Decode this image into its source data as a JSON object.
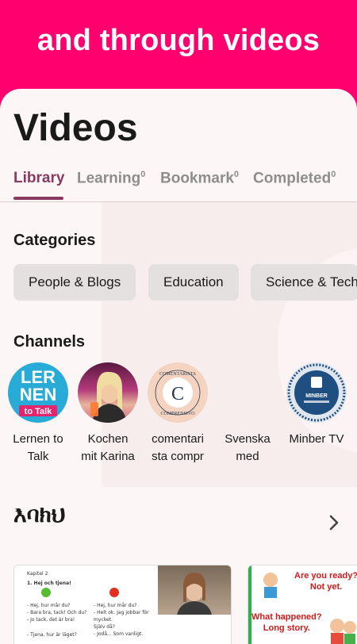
{
  "banner": {
    "title": "and through videos"
  },
  "page": {
    "title": "Videos"
  },
  "tabs": [
    {
      "label": "Library",
      "count": ""
    },
    {
      "label": "Learning",
      "count": "0"
    },
    {
      "label": "Bookmark",
      "count": "0"
    },
    {
      "label": "Completed",
      "count": "0"
    }
  ],
  "categories": {
    "title": "Categories",
    "items": [
      "People & Blogs",
      "Education",
      "Science & Tech"
    ]
  },
  "channels": {
    "title": "Channels",
    "items": [
      {
        "name": "Lernen to\nTalk",
        "logo_lines": [
          "LER",
          "NEN"
        ],
        "logo_sub": "to Talk",
        "color": "#29abd8"
      },
      {
        "name": "Kochen\nmit Karina",
        "color": "#c2307a"
      },
      {
        "name": "comentari\nsta compr",
        "logo_letter": "C",
        "logo_ring_top": "COMENTARISTA",
        "logo_ring_bottom": "COMPRENSIVO",
        "color": "#f4d4c0"
      },
      {
        "name": "Svenska\nmed",
        "color": "#fdf6f6"
      },
      {
        "name": "Minber TV",
        "logo_text": "MINBER",
        "color": "#1f4f80"
      }
    ]
  },
  "section": {
    "title": "እባክህ"
  },
  "thumbs": {
    "first": {
      "heading": "Kapitel 2",
      "sub": "1. Hej och tjena!",
      "lines_left": [
        "- Hej, hur mår du?",
        "- Bara bra, tack! Och du?",
        "- Jo tack, det är bra!",
        "- Tjena, hur är läget?"
      ],
      "lines_right": [
        "- Hej, hur mår du?",
        "- Helt ok. Jag jobbar för mycket.",
        "Själv då?",
        "- Jodå... Som vanligt."
      ]
    },
    "second": {
      "bubble_a": "Are you ready?\nNot yet.",
      "bubble_b": "What happened?\nLong story."
    }
  }
}
